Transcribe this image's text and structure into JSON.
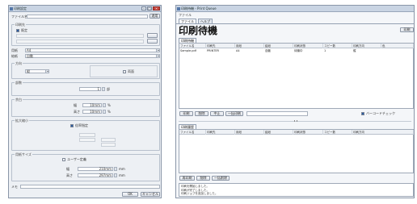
{
  "left_window": {
    "title": "印刷設定",
    "top": {
      "label": "ファイル名",
      "apply_button": "適用"
    },
    "printer_group": {
      "label": "印刷先",
      "default_printer_label": "既定",
      "device_label": "",
      "port_label": "",
      "props_button": "",
      "setup_button": ""
    },
    "paper": {
      "label": "用紙",
      "value": "A4"
    },
    "source": {
      "label": "給紙",
      "value": "自動"
    },
    "orientation_group": {
      "label": "方向",
      "value": "縦",
      "duplex_label": "両面"
    },
    "copies_group": {
      "label": "部数",
      "value": "1",
      "unit": "部"
    },
    "margins_group": {
      "label": "余白",
      "width_label": "幅",
      "width_value": "10mm",
      "height_label": "高さ",
      "height_value": "10mm",
      "unit": "%"
    },
    "scaling_group": {
      "label": "拡大縮小",
      "enable_label": "倍率指定",
      "mode_a": "",
      "mode_b": "",
      "rows": [
        "",
        "",
        "",
        ""
      ]
    },
    "custom_size_group": {
      "label": "用紙サイズ",
      "enable_label": "ユーザー定義",
      "sub_label": "",
      "width_label": "幅",
      "width_value": "210mm",
      "height_label": "高さ",
      "height_value": "297mm",
      "unit": "mm"
    },
    "memo_label": "メモ",
    "buttons": {
      "ok": "OK",
      "cancel": "キャンセル"
    }
  },
  "right_window": {
    "title": "印刷待機 - Print Queue",
    "menu": {
      "file": "ファイル",
      "tabs": [
        "ファイル",
        "ヘルプ"
      ]
    },
    "heading": "印刷待機",
    "top_right_button": "印刷",
    "queue_tab": "印刷待機",
    "columns": [
      "ファイル名",
      "印刷先",
      "用紙",
      "給紙",
      "印刷状態",
      "コピー数",
      "印刷方向",
      "色"
    ],
    "rows": [
      [
        "Sample.pdf",
        "PRINTER",
        "A4",
        "自動",
        "待機中",
        "1",
        "縦",
        ""
      ]
    ],
    "queue_buttons": [
      "印刷",
      "削除",
      "中止",
      "一括印刷"
    ],
    "bar_check_label": "バーコードチェック",
    "bar_status": "",
    "history_tab": "印刷履歴",
    "history_columns": [
      "ファイル名",
      "印刷先",
      "用紙",
      "給紙",
      "印刷状態",
      "コピー数",
      "印刷方向"
    ],
    "history_buttons": [
      "再印刷",
      "削除",
      "一括削除"
    ],
    "log": [
      "印刷を開始しました。",
      "印刷が完了しました。",
      "印刷ジョブを追加しました。"
    ]
  }
}
